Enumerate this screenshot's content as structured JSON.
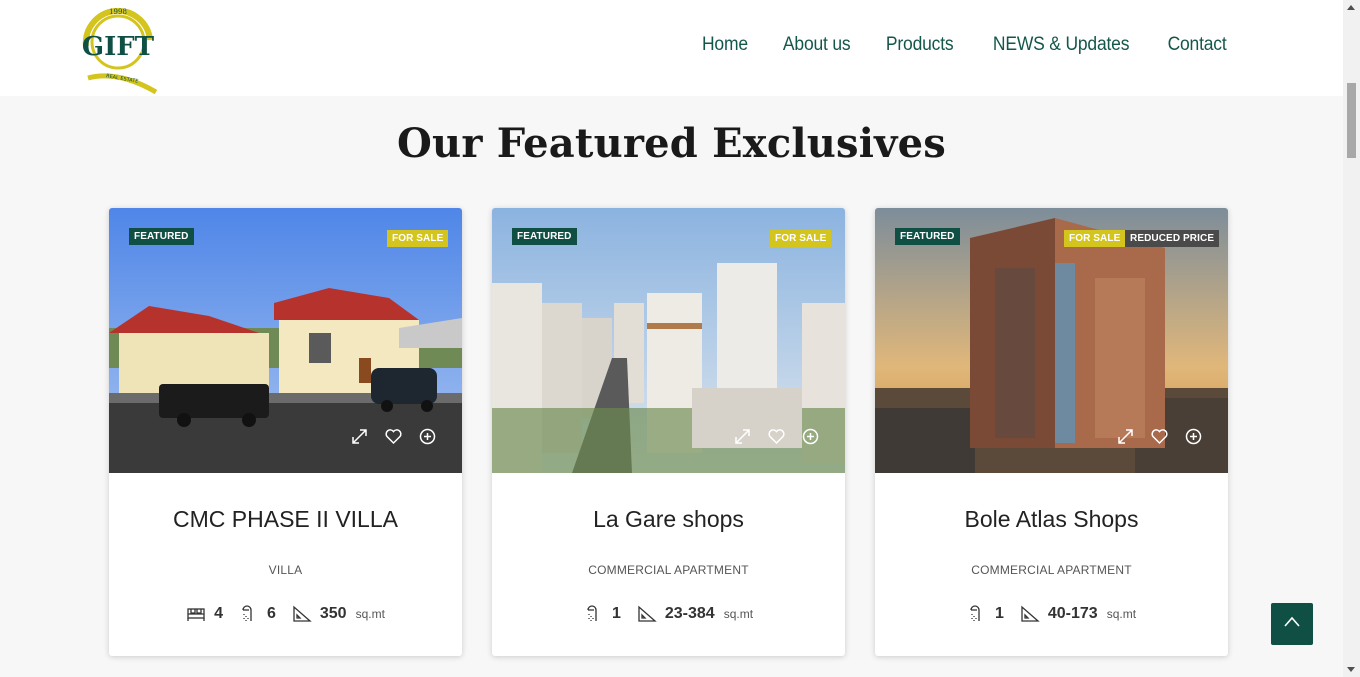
{
  "brand": {
    "logo_year": "1998",
    "logo_text": "GIFT",
    "logo_sub": "REAL ESTATE",
    "green": "#0f4f44",
    "yellow": "#d4c41e"
  },
  "nav": {
    "items": [
      "Home",
      "About us",
      "Products",
      "NEWS & Updates",
      "Contact"
    ]
  },
  "section": {
    "title": "Our Featured Exclusives"
  },
  "cards": [
    {
      "badge_featured": "FEATURED",
      "badge_sale": "FOR SALE",
      "badge_reduced": "",
      "title": "CMC PHASE II VILLA",
      "type": "VILLA",
      "beds": "4",
      "baths": "6",
      "area": "350",
      "unit": "sq.mt"
    },
    {
      "badge_featured": "FEATURED",
      "badge_sale": "FOR SALE",
      "badge_reduced": "",
      "title": "La Gare shops",
      "type": "COMMERCIAL APARTMENT",
      "baths": "1",
      "area": "23-384",
      "unit": "sq.mt"
    },
    {
      "badge_featured": "FEATURED",
      "badge_sale": "FOR SALE",
      "badge_reduced": "REDUCED PRICE",
      "title": "Bole Atlas Shops",
      "type": "COMMERCIAL APARTMENT",
      "baths": "1",
      "area": "40-173",
      "unit": "sq.mt"
    }
  ],
  "icons": {
    "expand": "expand-icon",
    "favorite": "heart-icon",
    "compare": "plus-circle-icon",
    "bed": "bed-icon",
    "bath": "shower-icon",
    "area": "ruler-triangle-icon",
    "back_to_top": "chevron-up-icon"
  }
}
